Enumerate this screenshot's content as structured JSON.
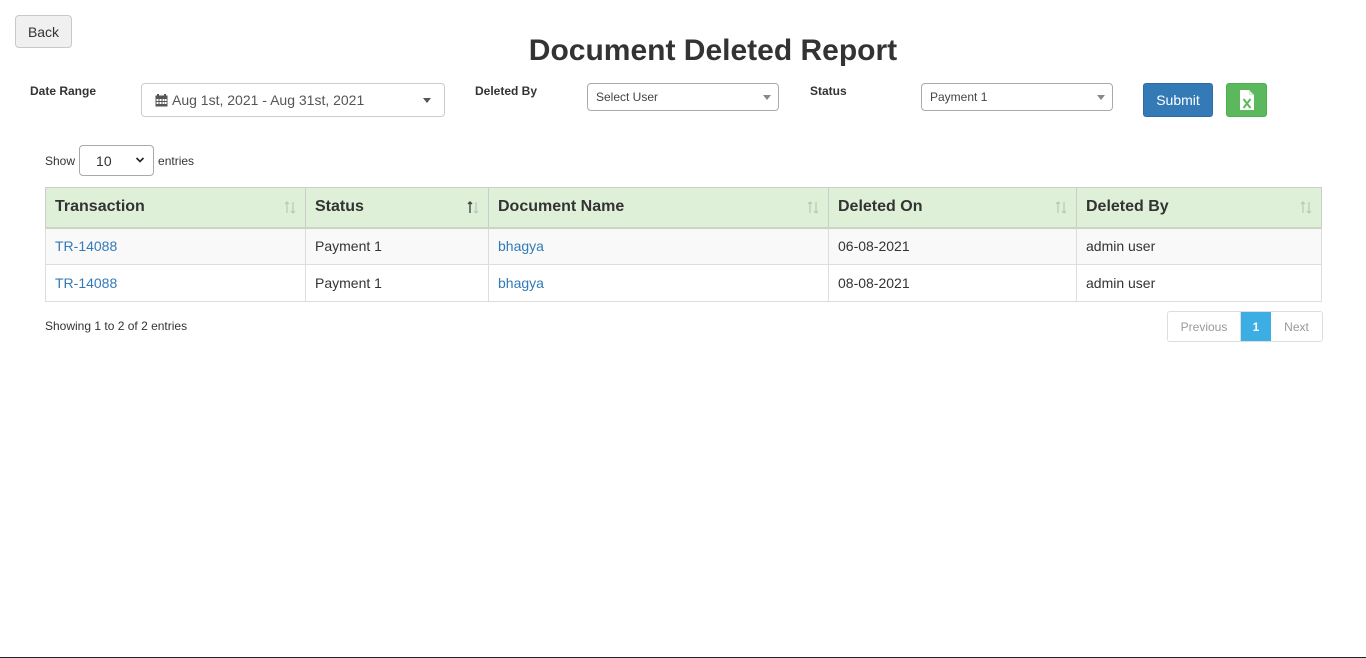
{
  "header": {
    "back_label": "Back",
    "title": "Document Deleted Report"
  },
  "filters": {
    "date_range_label": "Date Range",
    "date_range_value": "Aug 1st, 2021 - Aug 31st, 2021",
    "deleted_by_label": "Deleted By",
    "deleted_by_value": "Select User",
    "status_label": "Status",
    "status_value": "Payment 1",
    "submit_label": "Submit",
    "export_icon": "excel-icon"
  },
  "table_controls": {
    "show_label": "Show",
    "page_length": "10",
    "entries_label": "entries"
  },
  "table": {
    "columns": [
      "Transaction",
      "Status",
      "Document Name",
      "Deleted On",
      "Deleted By"
    ],
    "rows": [
      {
        "transaction": "TR-14088",
        "status": "Payment 1",
        "document_name": "bhagya",
        "deleted_on": "06-08-2021",
        "deleted_by": "admin user"
      },
      {
        "transaction": "TR-14088",
        "status": "Payment 1",
        "document_name": "bhagya",
        "deleted_on": "08-08-2021",
        "deleted_by": "admin user"
      }
    ]
  },
  "footer": {
    "info": "Showing 1 to 2 of 2 entries",
    "previous_label": "Previous",
    "current_page": "1",
    "next_label": "Next"
  },
  "colors": {
    "header_bg": "#dff0d8",
    "primary": "#337ab7",
    "success": "#5cb85c",
    "active_page": "#3caee3"
  }
}
